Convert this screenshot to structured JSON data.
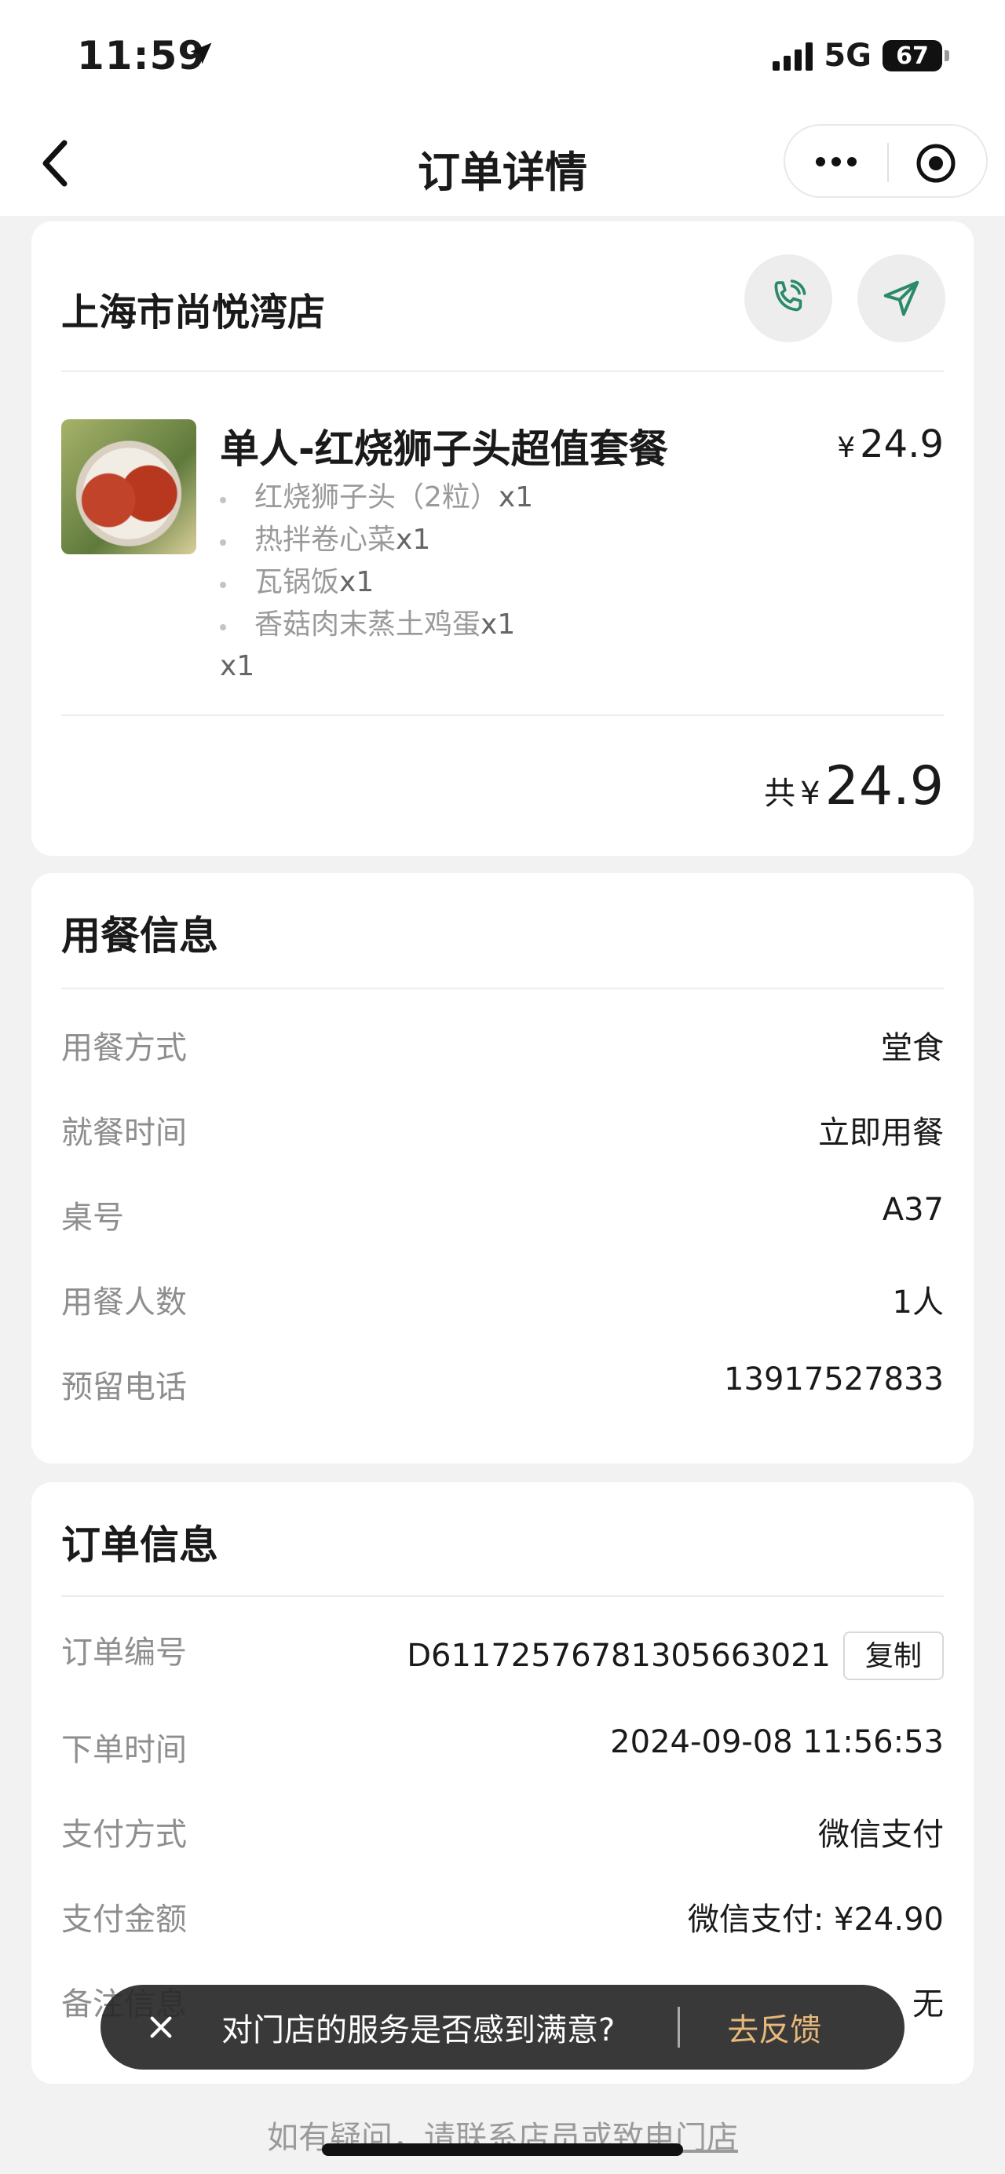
{
  "status_bar": {
    "time": "11:59",
    "network": "5G",
    "battery": "67"
  },
  "nav": {
    "title": "订单详情"
  },
  "store": {
    "name": "上海市尚悦湾店"
  },
  "product": {
    "title": "单人-红烧狮子头超值套餐",
    "price_symbol": "¥",
    "price": "24.9",
    "items": [
      {
        "name": "红烧狮子头（2粒）",
        "qty": "x1"
      },
      {
        "name": "热拌卷心菜",
        "qty": "x1"
      },
      {
        "name": "瓦锅饭",
        "qty": "x1"
      },
      {
        "name": "香菇肉末蒸土鸡蛋",
        "qty": "x1"
      }
    ],
    "quantity": "x1"
  },
  "total": {
    "label": "共",
    "symbol": "¥",
    "amount": "24.9"
  },
  "dining_info": {
    "title": "用餐信息",
    "rows": [
      {
        "label": "用餐方式",
        "value": "堂食"
      },
      {
        "label": "就餐时间",
        "value": "立即用餐"
      },
      {
        "label": "桌号",
        "value": "A37"
      },
      {
        "label": "用餐人数",
        "value": "1人"
      },
      {
        "label": "预留电话",
        "value": "13917527833"
      }
    ]
  },
  "order_info": {
    "title": "订单信息",
    "order_no_label": "订单编号",
    "order_no": "D6117257678130566302​1",
    "copy_label": "复制",
    "rows": [
      {
        "label": "下单时间",
        "value": "2024-09-08 11:56:53"
      },
      {
        "label": "支付方式",
        "value": "微信支付"
      },
      {
        "label": "支付金额",
        "value": "微信支付: ¥24.90"
      },
      {
        "label": "备注信息",
        "value": "无"
      }
    ]
  },
  "toast": {
    "text": "对门店的服务是否感到满意?",
    "action": "去反馈"
  },
  "footer": {
    "prefix": "如有疑问，",
    "link": "请联系店员或致电门店"
  }
}
